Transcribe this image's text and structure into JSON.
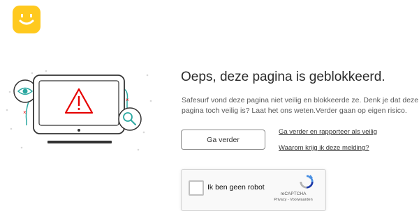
{
  "brand": {
    "logo_color": "#ffc91e",
    "logo_icon": "smiley-face-icon"
  },
  "page": {
    "title": "Oeps, deze pagina is geblokkeerd.",
    "description_line1": "Safesurf vond deze pagina niet veilig en blokkeerde ze. Denk je dat deze",
    "description_line2": "pagina toch veilig is? Laat het ons weten.Verder gaan op eigen risico."
  },
  "actions": {
    "continue_button": "Ga verder",
    "report_link": "Ga verder en rapporteer als veilig",
    "why_link": "Waarom krijg ik deze melding?"
  },
  "captcha": {
    "checkbox_label": "Ik ben geen robot",
    "brand": "reCAPTCHA",
    "terms": "Privacy - Voorwaarden"
  },
  "colors": {
    "warning_red": "#e60000",
    "illustration_teal": "#2aa7a0"
  },
  "illustration": {
    "icons": [
      "laptop-icon",
      "warning-triangle-icon",
      "eye-icon",
      "magnifier-icon"
    ]
  }
}
